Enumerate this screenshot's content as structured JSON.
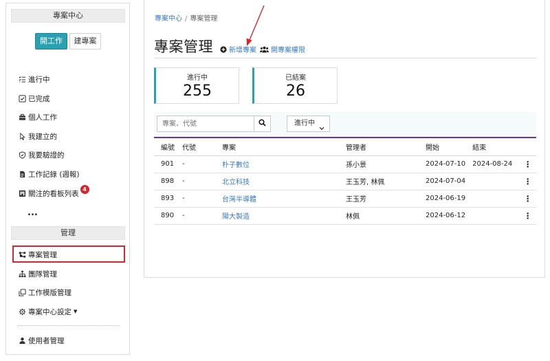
{
  "sidebar": {
    "header_project_center": "專案中心",
    "btn_open_work": "開工作",
    "btn_create_project": "建專案",
    "items": [
      {
        "label": "進行中",
        "icon": "list-check-icon"
      },
      {
        "label": "已完成",
        "icon": "checkbox-icon"
      },
      {
        "label": "個人工作",
        "icon": "briefcase-icon"
      },
      {
        "label": "我建立的",
        "icon": "cursor-icon"
      },
      {
        "label": "我要驗證的",
        "icon": "shield-check-icon"
      },
      {
        "label": "工作記錄 (週報)",
        "icon": "document-icon"
      },
      {
        "label": "關注的看板列表",
        "icon": "kanban-icon",
        "badge": "4"
      }
    ],
    "more": "...",
    "header_manage": "管理",
    "manage_items": [
      {
        "label": "專案管理",
        "icon": "project-tree-icon"
      },
      {
        "label": "團隊管理",
        "icon": "org-chart-icon"
      },
      {
        "label": "工作模版管理",
        "icon": "copy-icon"
      },
      {
        "label": "專案中心設定",
        "icon": "gear-icon"
      }
    ],
    "user_manage": "使用者管理"
  },
  "breadcrumb": {
    "root": "專案中心",
    "sep": "/",
    "current": "專案管理"
  },
  "page_title": "專案管理",
  "actions": {
    "new_project": "新增專案",
    "project_permission": "開專案權限"
  },
  "stats": [
    {
      "label": "進行中",
      "value": "255"
    },
    {
      "label": "已結案",
      "value": "26"
    }
  ],
  "filter": {
    "search_placeholder": "專案、代號",
    "status_selected": "進行中"
  },
  "table": {
    "headers": [
      "編號",
      "代號",
      "專案",
      "管理者",
      "開始",
      "結束"
    ],
    "rows": [
      {
        "id": "901",
        "code": "-",
        "project": "朴子數位",
        "manager": "孫小景",
        "start": "2024-07-10",
        "end": "2024-08-24"
      },
      {
        "id": "898",
        "code": "-",
        "project": "北立科技",
        "manager": "王玉芳, 林佩",
        "start": "2024-07-04",
        "end": ""
      },
      {
        "id": "893",
        "code": "-",
        "project": "台灣半導體",
        "manager": "王玉芳",
        "start": "2024-06-19",
        "end": ""
      },
      {
        "id": "890",
        "code": "-",
        "project": "陽大製造",
        "manager": "林佩",
        "start": "2024-06-12",
        "end": ""
      }
    ]
  },
  "colors": {
    "accent": "#2aa0b3",
    "table_rule": "#5e35b1",
    "link": "#3a7ab8",
    "highlight": "#d8262e",
    "badge": "#d9232d"
  }
}
